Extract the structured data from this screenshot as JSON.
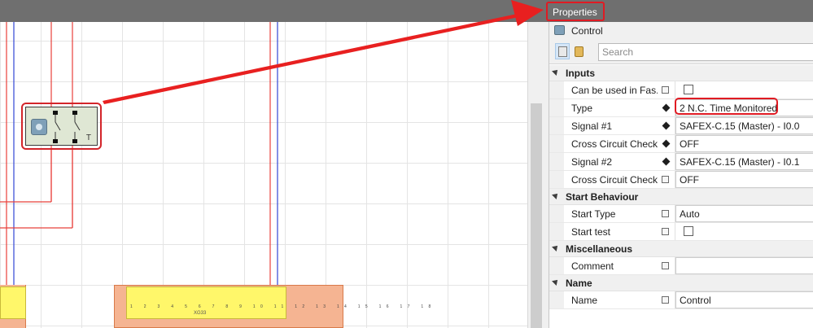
{
  "properties_panel": {
    "title": "Properties",
    "object_name": "Control",
    "search": {
      "placeholder": "Search"
    },
    "categories": [
      {
        "name": "Inputs",
        "props": [
          {
            "label": "Can be used in Fas...",
            "indicator": "edit-icon",
            "checkbox": false
          },
          {
            "label": "Type",
            "indicator": "diamond-icon",
            "value": "2 N.C. Time Monitored",
            "highlighted": true
          },
          {
            "label": "Signal #1",
            "indicator": "diamond-icon",
            "value": "SAFEX-C.15 (Master) - I0.0"
          },
          {
            "label": "Cross Circuit Check",
            "indicator": "diamond-icon",
            "value": "OFF"
          },
          {
            "label": "Signal #2",
            "indicator": "diamond-icon",
            "value": "SAFEX-C.15 (Master) - I0.1"
          },
          {
            "label": "Cross Circuit Check",
            "indicator": "edit-icon",
            "value": "OFF"
          }
        ]
      },
      {
        "name": "Start Behaviour",
        "props": [
          {
            "label": "Start Type",
            "indicator": "edit-icon",
            "value": "Auto"
          },
          {
            "label": "Start test",
            "indicator": "edit-icon",
            "checkbox": false
          }
        ]
      },
      {
        "name": "Miscellaneous",
        "props": [
          {
            "label": "Comment",
            "indicator": "edit-icon",
            "value": ""
          }
        ]
      },
      {
        "name": "Name",
        "props": [
          {
            "label": "Name",
            "indicator": "edit-icon",
            "value": "Control"
          }
        ]
      }
    ]
  },
  "canvas": {
    "control_block": {
      "symbol_label": "T"
    },
    "module": {
      "label": "XG33",
      "pin_numbers": "1 2 3 4 5 6 7 8 9 10 11 12 13 14 15 16 17 18"
    }
  },
  "colors": {
    "highlight_red": "#e01b23",
    "wire_red": "#e8403b",
    "wire_blue": "#3346d6",
    "module_orange": "#f5b492",
    "terminal_yellow": "#fff76a",
    "header_gray": "#6f6f6f"
  }
}
